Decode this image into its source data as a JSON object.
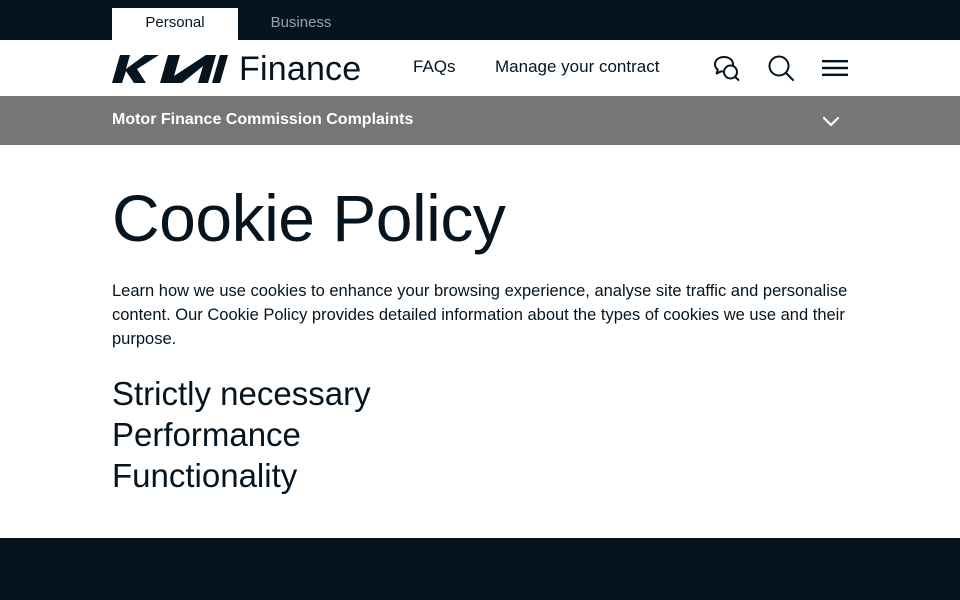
{
  "top_tabs": [
    {
      "label": "Personal",
      "active": true
    },
    {
      "label": "Business",
      "active": false
    }
  ],
  "header": {
    "logo_text": "Finance",
    "nav": [
      {
        "label": "FAQs"
      },
      {
        "label": "Manage your contract"
      }
    ],
    "icons": [
      "chat-icon",
      "search-icon",
      "menu-icon"
    ]
  },
  "banner": {
    "text": "Motor Finance Commission Complaints",
    "icon": "chevron-down-icon"
  },
  "main": {
    "title": "Cookie Policy",
    "intro": "Learn how we use cookies to enhance your browsing experience, analyse site traffic and personalise content. Our Cookie Policy provides detailed information about the types of cookies we use and their purpose.",
    "sections": [
      "Strictly necessary",
      "Performance",
      "Functionality"
    ]
  },
  "colors": {
    "navy": "#05141f",
    "banner_gray": "#767676",
    "inactive_tab": "#9ba1a6",
    "white": "#ffffff"
  }
}
